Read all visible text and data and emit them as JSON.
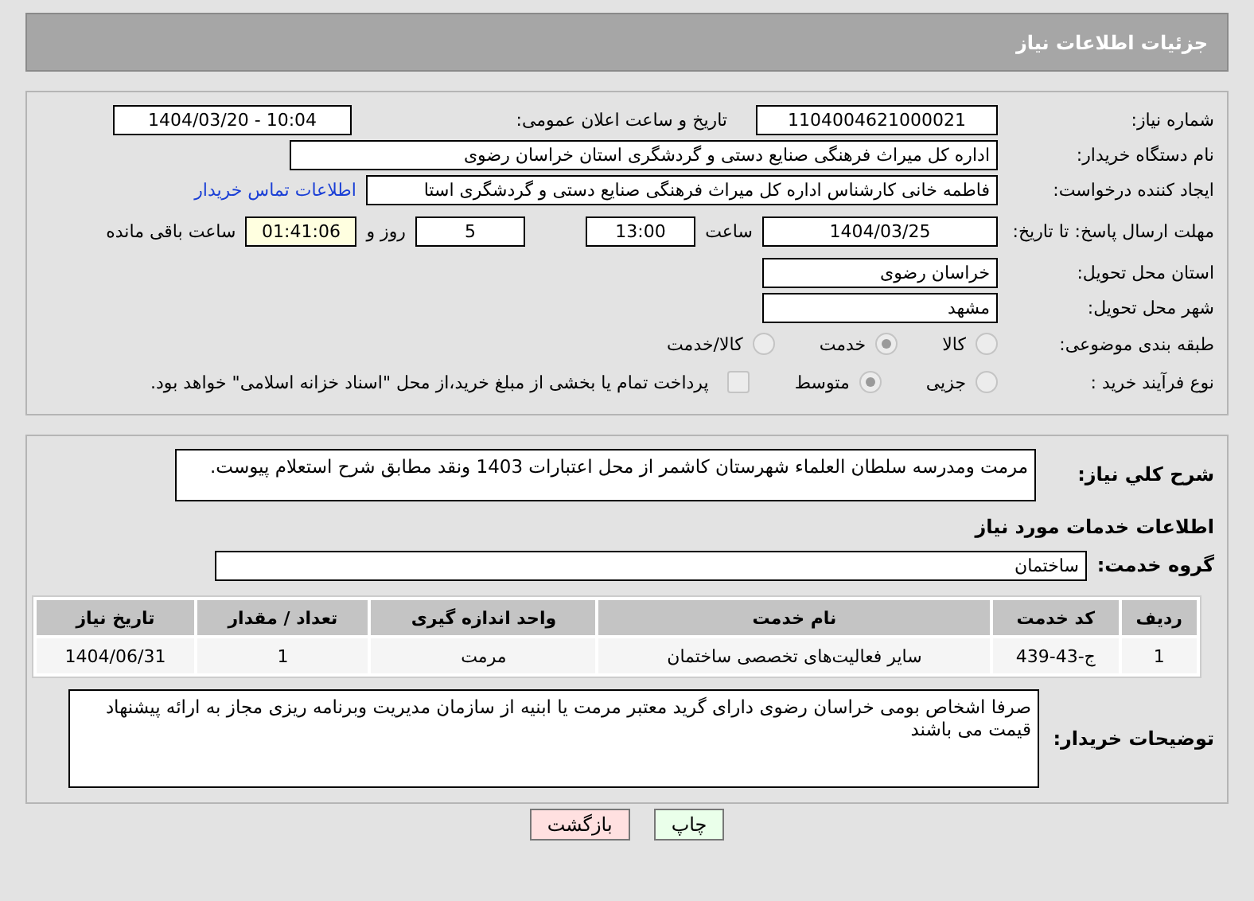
{
  "header": {
    "title": "جزئیات اطلاعات نیاز"
  },
  "details": {
    "need_number": {
      "label": "شماره نیاز:",
      "value": "1104004621000021"
    },
    "announce": {
      "label": "تاریخ و ساعت اعلان عمومی:",
      "value": "1404/03/20 - 10:04"
    },
    "buyer": {
      "label": "نام دستگاه خریدار:",
      "value": "اداره کل میراث فرهنگی  صنایع دستی و گردشگری استان خراسان رضوی"
    },
    "requester": {
      "label": "ایجاد کننده درخواست:",
      "value": "فاطمه خانی کارشناس اداره کل میراث فرهنگی  صنایع دستی و گردشگری استا",
      "link": "اطلاعات تماس خریدار"
    },
    "deadline": {
      "label": "مهلت ارسال پاسخ: تا تاریخ:",
      "date": "1404/03/25",
      "time_label": "ساعت",
      "time": "13:00",
      "days": "5",
      "days_label": "روز و",
      "remaining": "01:41:06",
      "remaining_label": "ساعت باقی مانده"
    },
    "province": {
      "label": "استان محل تحویل:",
      "value": "خراسان رضوی"
    },
    "city": {
      "label": "شهر محل تحویل:",
      "value": "مشهد"
    },
    "category": {
      "label": "طبقه بندی موضوعی:",
      "options": [
        {
          "label": "کالا",
          "selected": false
        },
        {
          "label": "خدمت",
          "selected": true
        },
        {
          "label": "کالا/خدمت",
          "selected": false
        }
      ]
    },
    "process": {
      "label": "نوع فرآیند خرید :",
      "options": [
        {
          "label": "جزیی",
          "selected": false
        },
        {
          "label": "متوسط",
          "selected": true
        }
      ],
      "payment": {
        "label": "پرداخت تمام یا بخشی از مبلغ خرید،از محل \"اسناد خزانه اسلامی\" خواهد بود.",
        "checked": false
      }
    }
  },
  "summary": {
    "label": "شرح کلي نياز:",
    "value": "مرمت ومدرسه سلطان العلماء شهرستان کاشمر از محل اعتبارات 1403 ونقد مطابق شرح استعلام پیوست."
  },
  "services_title": "اطلاعات خدمات مورد نیاز",
  "service_group": {
    "label": "گروه خدمت:",
    "value": "ساختمان"
  },
  "table": {
    "columns": [
      "ردیف",
      "کد خدمت",
      "نام خدمت",
      "واحد اندازه گیری",
      "تعداد / مقدار",
      "تاریخ نیاز"
    ],
    "rows": [
      [
        "1",
        "ج-43-439",
        "سایر فعالیت‌های تخصصی ساختمان",
        "مرمت",
        "1",
        "1404/06/31"
      ]
    ]
  },
  "buyer_notes": {
    "label": "توضیحات خریدار:",
    "value": "صرفا اشخاص بومی خراسان رضوی دارای گرید معتبر مرمت یا ابنیه از سازمان مدیریت وبرنامه ریزی مجاز به ارائه پیشنهاد قیمت می باشند"
  },
  "buttons": [
    {
      "label": "چاپ",
      "kind": "print"
    },
    {
      "label": "بازگشت",
      "kind": "back"
    }
  ]
}
